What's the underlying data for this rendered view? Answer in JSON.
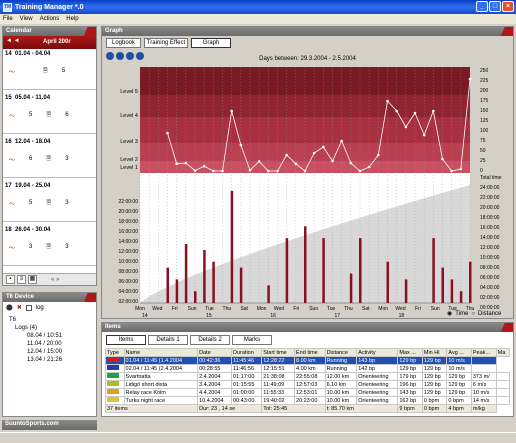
{
  "window": {
    "title": "Training Manager *.0"
  },
  "menu": [
    "File",
    "View",
    "Actions",
    "Help"
  ],
  "calendar": {
    "header": "Calendar",
    "month": "April 200r",
    "weeks": [
      {
        "num": "14",
        "range": "01.04 - 04.04",
        "a": "",
        "b": "5"
      },
      {
        "num": "15",
        "range": "05.04 - 11.04",
        "a": "5",
        "b": "6"
      },
      {
        "num": "16",
        "range": "12.04 - 18.04",
        "a": "6",
        "b": "3"
      },
      {
        "num": "17",
        "range": "19.04 - 25.04",
        "a": "5",
        "b": "3"
      },
      {
        "num": "18",
        "range": "26.04 - 30.04",
        "a": "3",
        "b": "3"
      }
    ]
  },
  "device": {
    "header": "T6 Device",
    "log_label": "log",
    "tree_root": "T6",
    "logs_label": "Logs (4)",
    "entries": [
      "08.04 / 10:51",
      "11.04 / 20:00",
      "12.04 / 15:00",
      "13.04 / 21:26"
    ]
  },
  "brand": "SuuntoSports.com",
  "graph": {
    "header": "Graph",
    "tabs": [
      "Logbook",
      "Training Effect",
      "Graph"
    ],
    "days_between": "Days between: 29.3.2004 - 2.5.2004",
    "levels": [
      "Level 5",
      "Level 4",
      "Level 3",
      "Level 2",
      "Level 1"
    ],
    "right_ticks_top": [
      "250",
      "225",
      "200",
      "175",
      "150",
      "125",
      "100",
      "75",
      "50",
      "25",
      "0"
    ],
    "total_time_label": "Total time",
    "right_ticks_bottom": [
      "24:00:00",
      "22:00:00",
      "20:00:00",
      "18:00:00",
      "16:00:00",
      "14:00:00",
      "12:00:00",
      "10:00:00",
      "08:00:00",
      "06:00:00",
      "04:00:00",
      "02:00:00",
      "00:00:00"
    ],
    "left_ticks_bottom": [
      "22:00:00",
      "20:00:00",
      "18:00:00",
      "16:00:00",
      "14:00:00",
      "12:00:00",
      "10:00:00",
      "08:00:00",
      "06:00:00",
      "04:00:00",
      "02:00:00"
    ],
    "x_days": [
      "Mon",
      "Wed",
      "Fri",
      "Sun",
      "Tue",
      "Thu",
      "Sat",
      "Mon",
      "Wed",
      "Fri",
      "Sun",
      "Tue",
      "Thu",
      "Sat",
      "Mon",
      "Wed",
      "Fri",
      "Sun",
      "Tue",
      "Thu"
    ],
    "x_weeks": [
      {
        "label": "Mon 14",
        "at": 0
      },
      {
        "label": "Mon 15",
        "at": 7
      },
      {
        "label": "Mon 16",
        "at": 14
      },
      {
        "label": "Mon 17",
        "at": 21
      },
      {
        "label": "Mon 18",
        "at": 28
      }
    ],
    "radio_time": "Time",
    "radio_distance": "Distance"
  },
  "chart_data": {
    "type": "line",
    "title": "Days between: 29.3.2004 - 2.5.2004",
    "ylabel_right": "Total time",
    "series": [
      {
        "name": "TE",
        "values": [
          null,
          null,
          null,
          95,
          18,
          20,
          1,
          12,
          0,
          0,
          150,
          65,
          2,
          24,
          0,
          0,
          40,
          18,
          0,
          45,
          60,
          25,
          75,
          20,
          0,
          10,
          40,
          175,
          150,
          110,
          145,
          90,
          150,
          30,
          0,
          5,
          230
        ]
      }
    ]
  },
  "items": {
    "header": "Items",
    "tabs": [
      "Items",
      "Details 1",
      "Details 2",
      "Marks"
    ],
    "columns": [
      "Type",
      "Name",
      "Date",
      "Duration",
      "Start time",
      "End time",
      "Distance",
      "Activity",
      "Max ...",
      "Min Hl",
      "Avg ...",
      "Peak...",
      "Ma"
    ],
    "rows": [
      {
        "color": "#cc2020",
        "cells": [
          "",
          "01.04 / 11:45 (1.4.2004",
          "00:42:36",
          "11:45:46",
          "12:28:22",
          "8.00 km",
          "Running",
          "143 bp",
          "129 bp",
          "129 bp",
          "10 m/s",
          ""
        ]
      },
      {
        "color": "#2040a8",
        "cells": [
          "",
          "02.04 / 11:45 (2.4.2004",
          "00:28:55",
          "11:46:56",
          "12:15:51",
          "4.00 km",
          "Running",
          "142 bp",
          "129 bp",
          "129 bp",
          "10 m/s",
          ""
        ]
      },
      {
        "color": "#20a040",
        "cells": [
          "",
          "Svartnatta",
          "2.4.2004",
          "01:17:00",
          "21:38:08",
          "22:55:08",
          "12.00 km",
          "Orienteering",
          "179 bp",
          "129 bp",
          "129 bp",
          "373 m/",
          ""
        ]
      },
      {
        "color": "#a8c020",
        "cells": [
          "",
          "Lidigö short dista",
          "3.4.2004",
          "01:15:55",
          "11:49:09",
          "12:57:03",
          "6.10 km",
          "Orienteering",
          "196 bp",
          "129 bp",
          "129 bp",
          "6 m/s",
          ""
        ]
      },
      {
        "color": "#e0a020",
        "cells": [
          "",
          "Relay race Kolm",
          "4.4.2004",
          "01:00:00",
          "11:55:33",
          "12:53:01",
          "10.00 km",
          "Orienteering",
          "143 bp",
          "129 bp",
          "129 bp",
          "10 m/s",
          ""
        ]
      },
      {
        "color": "#e0c040",
        "cells": [
          "",
          "Turku night race",
          "10.4.2004",
          "00:43:00",
          "19:40:02",
          "20:23:00",
          "10.00 km",
          "Orienteering",
          "162 bp",
          "0 bpm",
          "0 bpm",
          "14 m/s",
          ""
        ]
      }
    ],
    "footer": {
      "items": "37 items",
      "duration": "Dur: 23 , 14 se",
      "tot": "Tot: 25:45",
      "dist": "t: 85.70 km",
      "max": "9 bpm",
      "min": "0 bpm",
      "avg": "4 bpm",
      "peak": "m/kg"
    }
  }
}
